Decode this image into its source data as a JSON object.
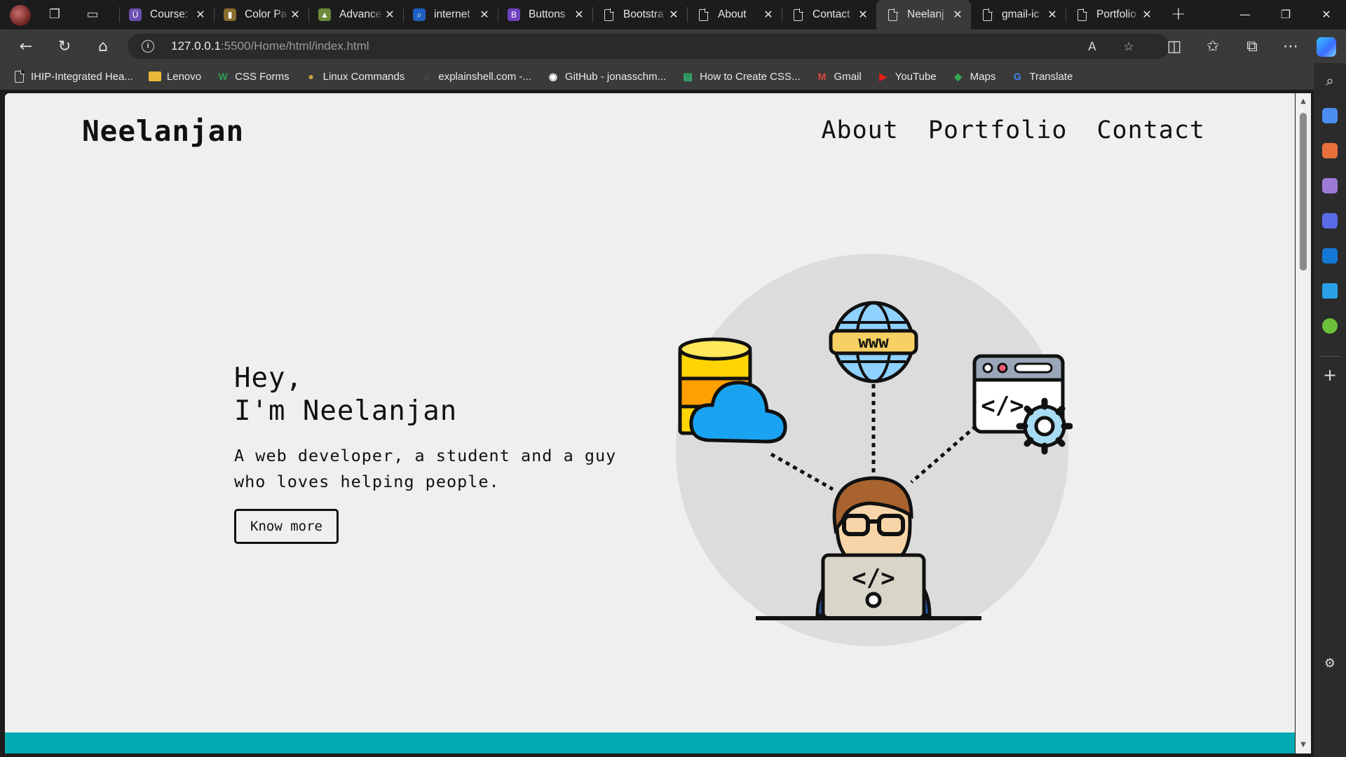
{
  "browser": {
    "tabs": [
      {
        "title": "Course:",
        "fav": "Ü",
        "fav_color": "#6b4fb0"
      },
      {
        "title": "Color Pa",
        "fav": "▮",
        "fav_color": "#8a6b2f"
      },
      {
        "title": "Advance",
        "fav": "▲",
        "fav_color": "#6d8a3a"
      },
      {
        "title": "internet",
        "fav": "⌕",
        "fav_color": "#1f5fbf"
      },
      {
        "title": "Buttons",
        "fav": "B",
        "fav_color": "#6f42c1"
      },
      {
        "title": "Bootstra",
        "fav": "doc",
        "fav_color": ""
      },
      {
        "title": "About",
        "fav": "doc",
        "fav_color": ""
      },
      {
        "title": "Contact",
        "fav": "doc",
        "fav_color": ""
      },
      {
        "title": "Neelanj",
        "fav": "doc",
        "fav_color": "",
        "active": true
      },
      {
        "title": "gmail-ic",
        "fav": "doc",
        "fav_color": ""
      },
      {
        "title": "Portfolio",
        "fav": "doc",
        "fav_color": ""
      }
    ],
    "url_host": "127.0.0.1",
    "url_rest": ":5500/Home/html/index.html",
    "bookmarks": [
      {
        "label": "IHIP-Integrated Hea...",
        "icon": "doc",
        "color": ""
      },
      {
        "label": "Lenovo",
        "icon": "folder",
        "color": "#e8b93a"
      },
      {
        "label": "CSS Forms",
        "icon": "W",
        "color": "#2e9b4f"
      },
      {
        "label": "Linux Commands",
        "icon": "●",
        "color": "#c9a645"
      },
      {
        "label": "explainshell.com -...",
        "icon": "▲",
        "color": "#444"
      },
      {
        "label": "GitHub - jonasschm...",
        "icon": "◉",
        "color": "#ffffff"
      },
      {
        "label": "How to Create CSS...",
        "icon": "▤",
        "color": "#2fbf71"
      },
      {
        "label": "Gmail",
        "icon": "M",
        "color": "#d94a3d"
      },
      {
        "label": "YouTube",
        "icon": "▶",
        "color": "#e62117"
      },
      {
        "label": "Maps",
        "icon": "◆",
        "color": "#34a853"
      },
      {
        "label": "Translate",
        "icon": "G",
        "color": "#4285f4"
      }
    ]
  },
  "site": {
    "logo": "Neelanjan",
    "nav": [
      "About",
      "Portfolio",
      "Contact"
    ],
    "greeting_line1": "Hey,",
    "greeting_line2": "I'm Neelanjan",
    "description": "A web developer, a student and a guy who loves helping people.",
    "cta": "Know more",
    "illustration_label": "www",
    "footer_color": "#00aab2"
  }
}
